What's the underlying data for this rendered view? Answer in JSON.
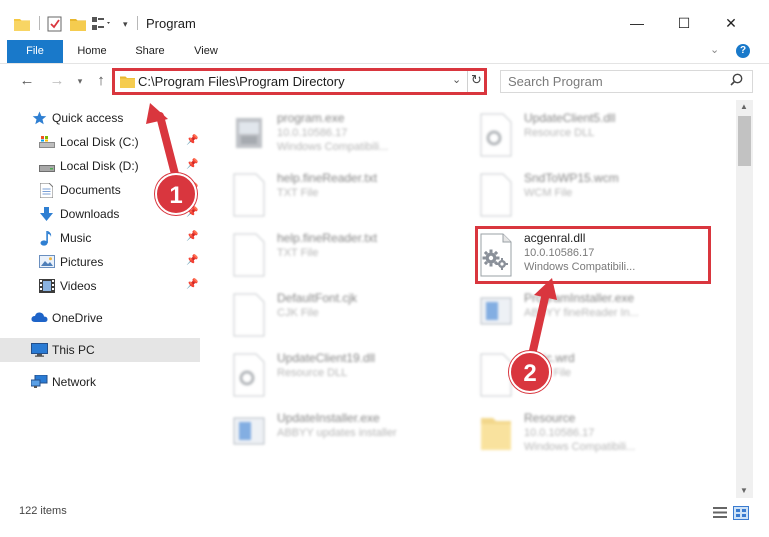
{
  "window": {
    "title": "Program",
    "minimize": "—",
    "maximize": "☐",
    "close": "✕"
  },
  "ribbon": {
    "tabs": [
      {
        "label": "File"
      },
      {
        "label": "Home"
      },
      {
        "label": "Share"
      },
      {
        "label": "View"
      }
    ],
    "help": "?"
  },
  "nav": {
    "address": "C:\\Program Files\\Program Directory",
    "search_placeholder": "Search Program"
  },
  "sidebar": {
    "items": [
      {
        "label": "Quick access",
        "icon": "star-icon",
        "pinned": false
      },
      {
        "label": "Local Disk (C:)",
        "icon": "drive-icon",
        "pinned": true
      },
      {
        "label": "Local Disk (D:)",
        "icon": "drive-icon",
        "pinned": true
      },
      {
        "label": "Documents",
        "icon": "documents-icon",
        "pinned": true
      },
      {
        "label": "Downloads",
        "icon": "download-icon",
        "pinned": true
      },
      {
        "label": "Music",
        "icon": "music-icon",
        "pinned": true
      },
      {
        "label": "Pictures",
        "icon": "pictures-icon",
        "pinned": true
      },
      {
        "label": "Videos",
        "icon": "videos-icon",
        "pinned": true
      },
      {
        "label": "OneDrive",
        "icon": "cloud-icon",
        "pinned": false
      },
      {
        "label": "This PC",
        "icon": "computer-icon",
        "pinned": false
      },
      {
        "label": "Network",
        "icon": "network-icon",
        "pinned": false
      }
    ]
  },
  "files": [
    {
      "name": "program.exe",
      "meta1": "10.0.10586.17",
      "meta2": "Windows Compatibili...",
      "icon": "exe-icon",
      "blurred": true
    },
    {
      "name": "UpdateClient5.dll",
      "meta1": "Resource DLL",
      "meta2": "",
      "icon": "dll-icon",
      "blurred": true
    },
    {
      "name": "help.fineReader.txt",
      "meta1": "TXT File",
      "meta2": "",
      "icon": "txt-file-icon",
      "blurred": true
    },
    {
      "name": "SndToWP15.wcm",
      "meta1": "WCM File",
      "meta2": "",
      "icon": "generic-file-icon",
      "blurred": true
    },
    {
      "name": "help.fineReader.txt",
      "meta1": "TXT File",
      "meta2": "",
      "icon": "txt-file-icon",
      "blurred": true
    },
    {
      "name": "acgenral.dll",
      "meta1": "10.0.10586.17",
      "meta2": "Windows Compatibili...",
      "icon": "dll-gear-icon",
      "blurred": false
    },
    {
      "name": "DefaultFont.cjk",
      "meta1": "CJK File",
      "meta2": "",
      "icon": "generic-file-icon",
      "blurred": true
    },
    {
      "name": "ProgramInstaller.exe",
      "meta1": "ABBYY fineReader In...",
      "meta2": "",
      "icon": "installer-icon",
      "blurred": true
    },
    {
      "name": "UpdateClient19.dll",
      "meta1": "Resource DLL",
      "meta2": "",
      "icon": "dll-icon",
      "blurred": true
    },
    {
      "name": "basic.wrd",
      "meta1": "WRD File",
      "meta2": "",
      "icon": "generic-file-icon",
      "blurred": true
    },
    {
      "name": "UpdateInstaller.exe",
      "meta1": "ABBYY updates installer",
      "meta2": "",
      "icon": "installer-icon",
      "blurred": true
    },
    {
      "name": "Resource",
      "meta1": "10.0.10586.17",
      "meta2": "Windows Compatibili...",
      "icon": "folder-icon",
      "blurred": true
    }
  ],
  "status": {
    "items_count": "122 items"
  },
  "annotations": {
    "badge1": "1",
    "badge2": "2",
    "color": "#d9363e"
  },
  "colors": {
    "accent": "#1979ca",
    "highlight": "#d9363e"
  }
}
